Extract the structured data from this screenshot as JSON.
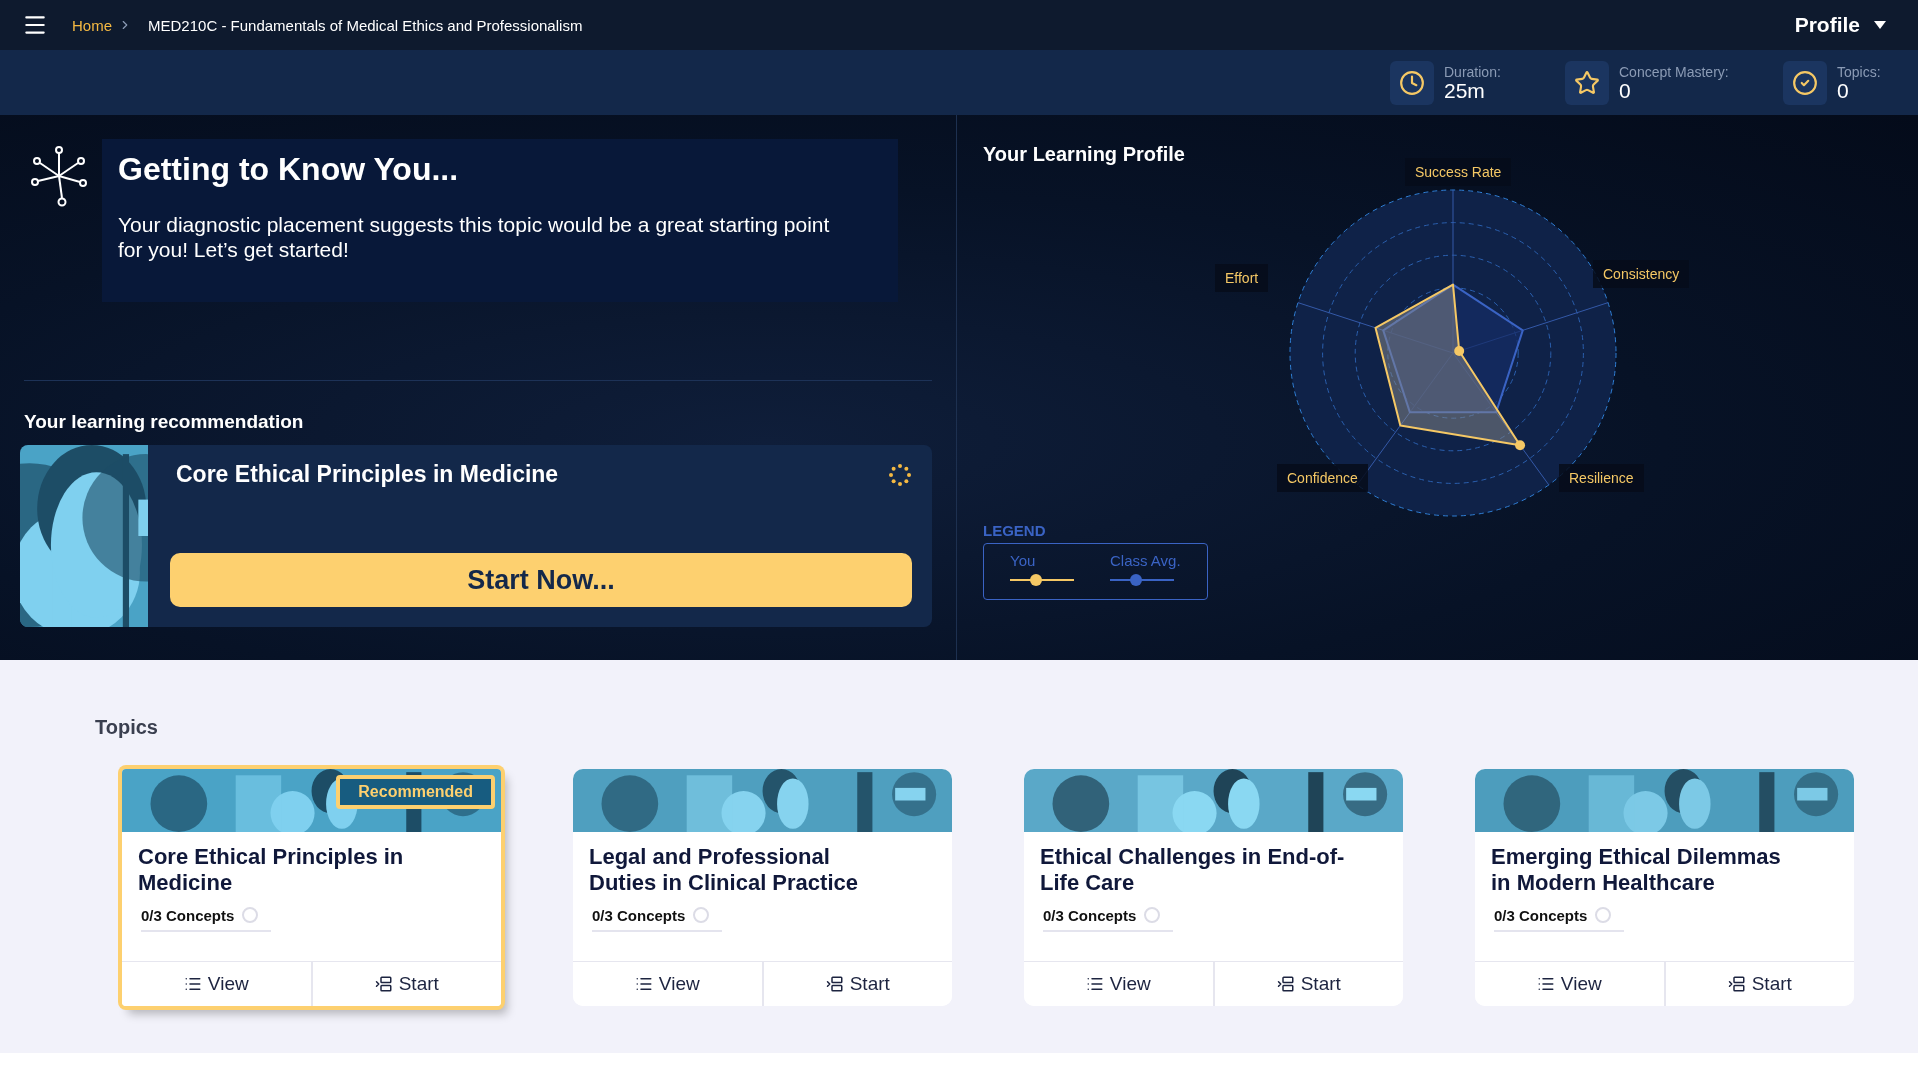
{
  "top_bar": {
    "breadcrumb": [
      {
        "label": "Home",
        "kind": "link"
      },
      {
        "label": "MED210C - Fundamentals of Medical Ethics and Professionalism",
        "kind": "current"
      }
    ],
    "profile": "Profile"
  },
  "stats": [
    {
      "kind": "duration",
      "label": "Duration:",
      "value": "25m"
    },
    {
      "kind": "mastery",
      "label": "Concept Mastery:",
      "value": "0"
    },
    {
      "kind": "topics",
      "label": "Topics:",
      "value": "0"
    }
  ],
  "intro": {
    "title": "Getting to Know You...",
    "text": "Your diagnostic placement suggests this topic would be a great starting point for you! Let’s get started!"
  },
  "recommendation": {
    "heading": "Your learning recommendation",
    "title": "Core Ethical Principles in Medicine",
    "button": "Start Now..."
  },
  "learning_profile": {
    "title": "Your Learning Profile",
    "axes": [
      "Success Rate",
      "Consistency",
      "Resilience",
      "Confidence",
      "Effort"
    ],
    "legend_title": "LEGEND",
    "legend": [
      {
        "label": "You",
        "color": "#f5c865"
      },
      {
        "label": "Class Avg.",
        "color": "#3a63c4"
      }
    ]
  },
  "topics": {
    "heading": "Topics",
    "cards": [
      {
        "title": "Core Ethical Principles in Medicine",
        "recommended": true,
        "badge": "Recommended",
        "concepts": "0/3 Concepts",
        "view": "View",
        "start": "Start"
      },
      {
        "title": "Legal and Professional Duties in Clinical Practice",
        "recommended": false,
        "concepts": "0/3 Concepts",
        "view": "View",
        "start": "Start"
      },
      {
        "title": "Ethical Challenges in End-of-Life Care",
        "recommended": false,
        "concepts": "0/3 Concepts",
        "view": "View",
        "start": "Start"
      },
      {
        "title": "Emerging Ethical Dilemmas in Modern Healthcare",
        "recommended": false,
        "concepts": "0/3 Concepts",
        "view": "View",
        "start": "Start"
      }
    ]
  }
}
